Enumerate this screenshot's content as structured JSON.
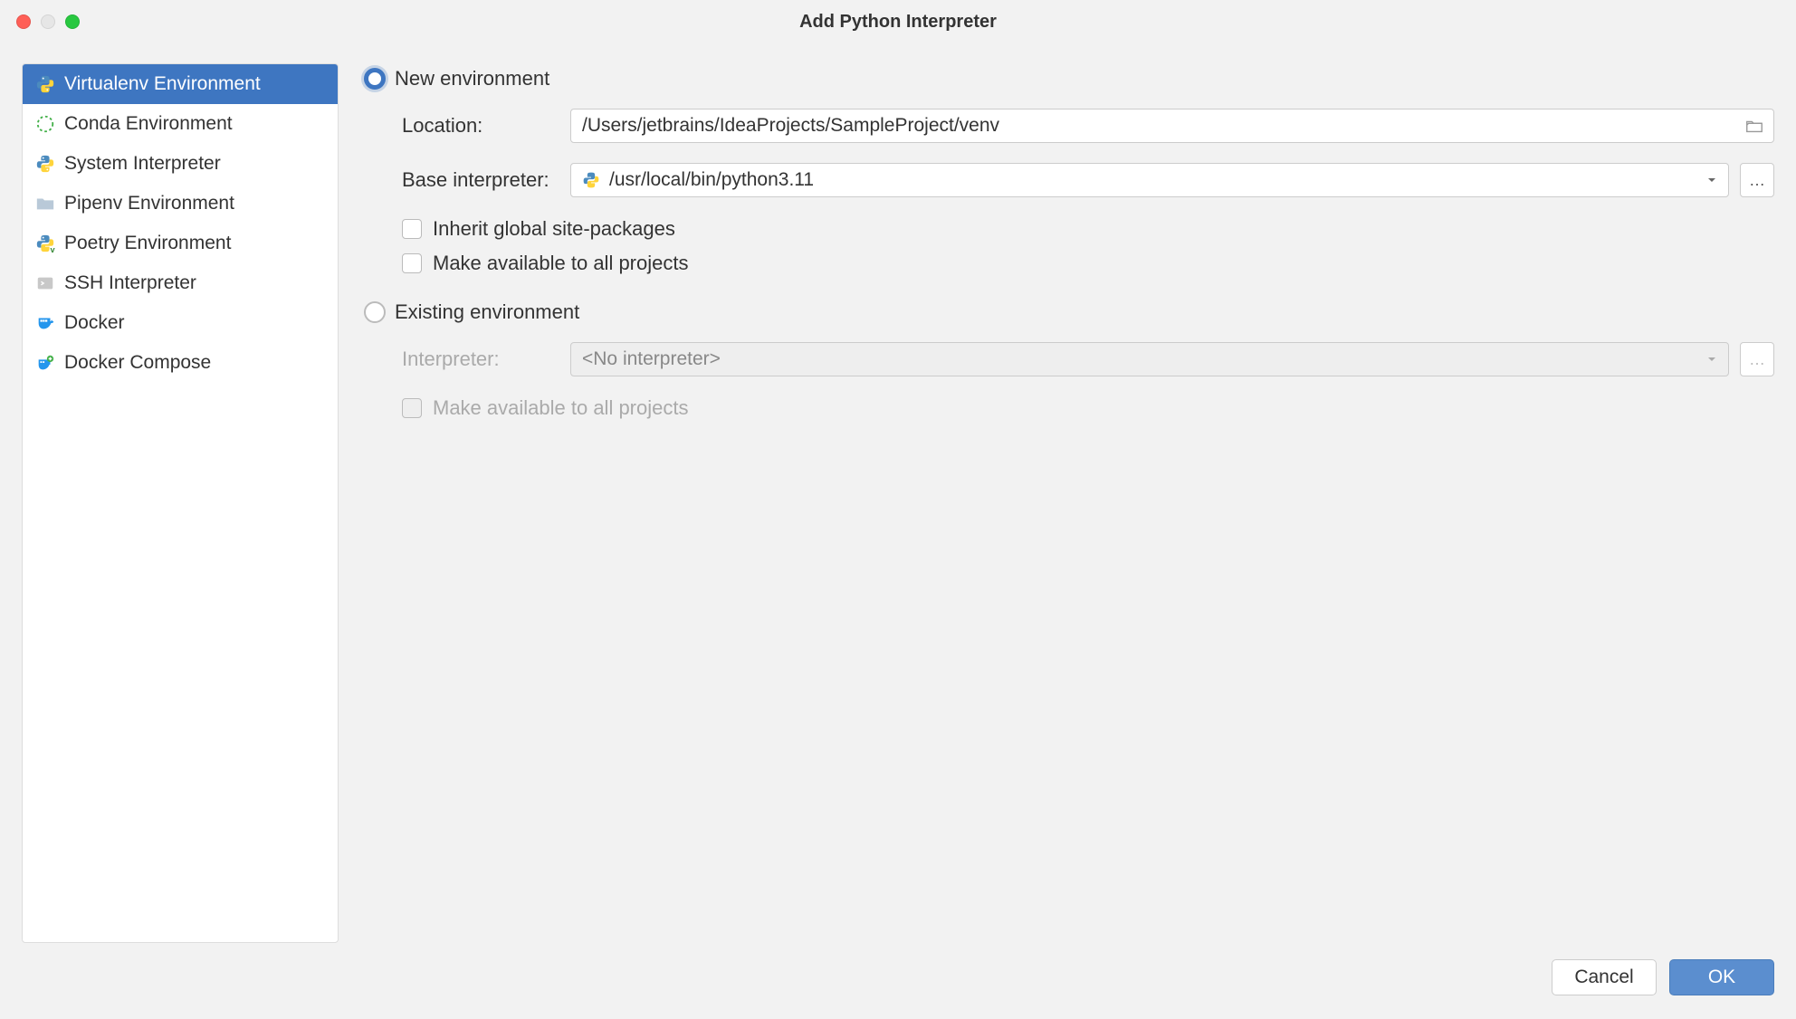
{
  "window_title": "Add Python Interpreter",
  "sidebar": {
    "items": [
      {
        "label": "Virtualenv Environment",
        "icon": "python"
      },
      {
        "label": "Conda Environment",
        "icon": "conda"
      },
      {
        "label": "System Interpreter",
        "icon": "python"
      },
      {
        "label": "Pipenv Environment",
        "icon": "folder"
      },
      {
        "label": "Poetry Environment",
        "icon": "python-v"
      },
      {
        "label": "SSH Interpreter",
        "icon": "ssh"
      },
      {
        "label": "Docker",
        "icon": "docker"
      },
      {
        "label": "Docker Compose",
        "icon": "docker-compose"
      }
    ]
  },
  "form": {
    "new_env_label": "New environment",
    "location_label": "Location:",
    "location_value": "/Users/jetbrains/IdeaProjects/SampleProject/venv",
    "base_interpreter_label": "Base interpreter:",
    "base_interpreter_value": "/usr/local/bin/python3.11",
    "inherit_label": "Inherit global site-packages",
    "make_available_label": "Make available to all projects",
    "existing_env_label": "Existing environment",
    "interpreter_label": "Interpreter:",
    "interpreter_value": "<No interpreter>",
    "make_available_existing_label": "Make available to all projects"
  },
  "footer": {
    "cancel_label": "Cancel",
    "ok_label": "OK"
  }
}
